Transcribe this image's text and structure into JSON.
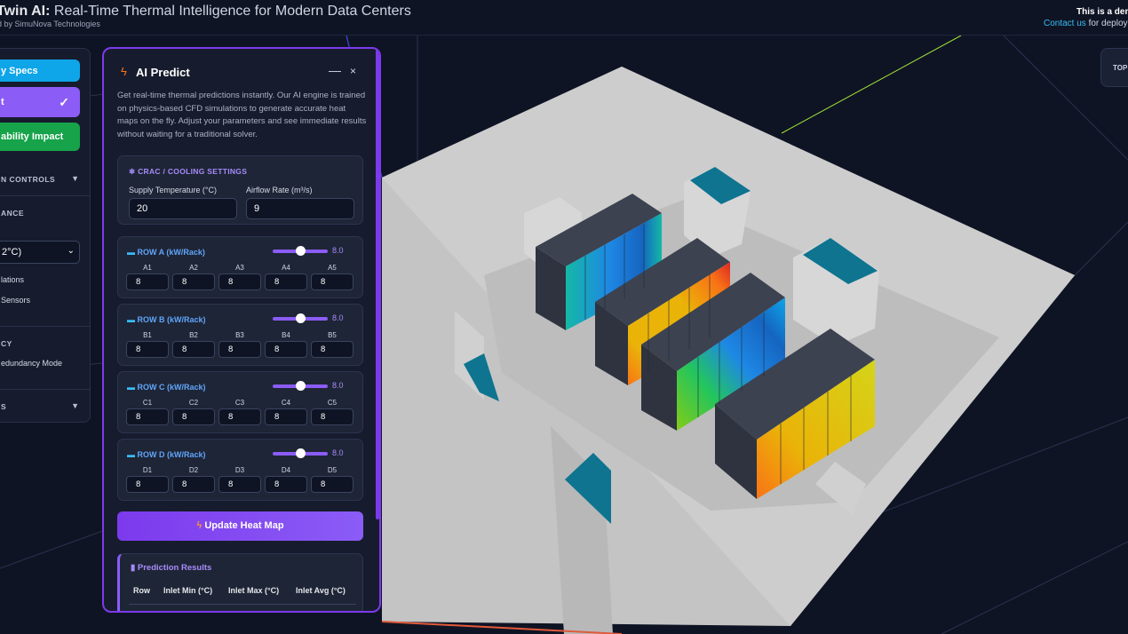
{
  "header": {
    "title_bold": "Twin AI:",
    "title_rest": " Real-Time Thermal Intelligence for Modern Data Centers",
    "byline": "ed by SimuNova Technologies",
    "demo_note": "This is a dem",
    "contact_link": "Contact us",
    "contact_rest": " for deploy"
  },
  "topview": {
    "label": "TOP"
  },
  "sidebar": {
    "specs_label": "y Specs",
    "predict_label": "t",
    "predict_check": "✓",
    "sustain_label": "ability Impact",
    "sim_controls": "N CONTROLS",
    "section_ance": "ANCE",
    "select_value": "2°C)",
    "lations": "lations",
    "sensors": "Sensors",
    "section_cy": "CY",
    "redundancy": "edundancy Mode",
    "section_s": "S"
  },
  "panel": {
    "title": "AI Predict",
    "minimize": "—",
    "close": "×",
    "intro": "Get real-time thermal predictions instantly. Our AI engine is trained on physics-based CFD simulations to generate accurate heat maps on the fly. Adjust your parameters and see immediate results without waiting for a traditional solver.",
    "crac": {
      "caption": "CRAC / COOLING SETTINGS",
      "supply_label": "Supply Temperature (°C)",
      "supply_value": "20",
      "airflow_label": "Airflow Rate (m³/s)",
      "airflow_value": "9"
    },
    "rows": [
      {
        "title": "ROW A (kW/Rack)",
        "value": "8.0",
        "level": 0.5,
        "racks": [
          {
            "l": "A1",
            "v": "8"
          },
          {
            "l": "A2",
            "v": "8"
          },
          {
            "l": "A3",
            "v": "8"
          },
          {
            "l": "A4",
            "v": "8"
          },
          {
            "l": "A5",
            "v": "8"
          }
        ]
      },
      {
        "title": "ROW B (kW/Rack)",
        "value": "8.0",
        "level": 0.5,
        "racks": [
          {
            "l": "B1",
            "v": "8"
          },
          {
            "l": "B2",
            "v": "8"
          },
          {
            "l": "B3",
            "v": "8"
          },
          {
            "l": "B4",
            "v": "8"
          },
          {
            "l": "B5",
            "v": "8"
          }
        ]
      },
      {
        "title": "ROW C (kW/Rack)",
        "value": "8.0",
        "level": 0.5,
        "racks": [
          {
            "l": "C1",
            "v": "8"
          },
          {
            "l": "C2",
            "v": "8"
          },
          {
            "l": "C3",
            "v": "8"
          },
          {
            "l": "C4",
            "v": "8"
          },
          {
            "l": "C5",
            "v": "8"
          }
        ]
      },
      {
        "title": "ROW D (kW/Rack)",
        "value": "8.0",
        "level": 0.5,
        "racks": [
          {
            "l": "D1",
            "v": "8"
          },
          {
            "l": "D2",
            "v": "8"
          },
          {
            "l": "D3",
            "v": "8"
          },
          {
            "l": "D4",
            "v": "8"
          },
          {
            "l": "D5",
            "v": "8"
          }
        ]
      }
    ],
    "update_label": "Update Heat Map",
    "results": {
      "title": "Prediction Results",
      "headers": [
        "Row",
        "Inlet Min (°C)",
        "Inlet Max (°C)",
        "Inlet Avg (°C)"
      ]
    }
  }
}
